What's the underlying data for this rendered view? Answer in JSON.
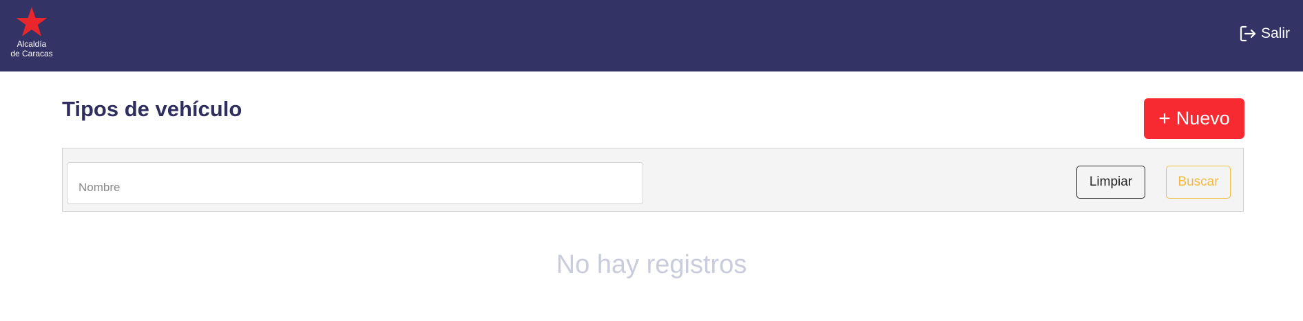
{
  "header": {
    "logo_text": "Alcaldía\nde Caracas",
    "logout_label": "Salir"
  },
  "colors": {
    "header_bg": "#343366",
    "accent_red": "#f72a31",
    "search_yellow": "#f2b93c",
    "title": "#2f2e5e"
  },
  "icons": {
    "logo": "red-star-icon",
    "logout": "logout-icon"
  },
  "main": {
    "title": "Tipos de vehículo",
    "new_button_label": "Nuevo",
    "new_button_icon": "+"
  },
  "filters": {
    "name_placeholder": "Nombre",
    "name_value": "",
    "clear_label": "Limpiar",
    "search_label": "Buscar"
  },
  "results": {
    "empty_message": "No hay registros"
  }
}
